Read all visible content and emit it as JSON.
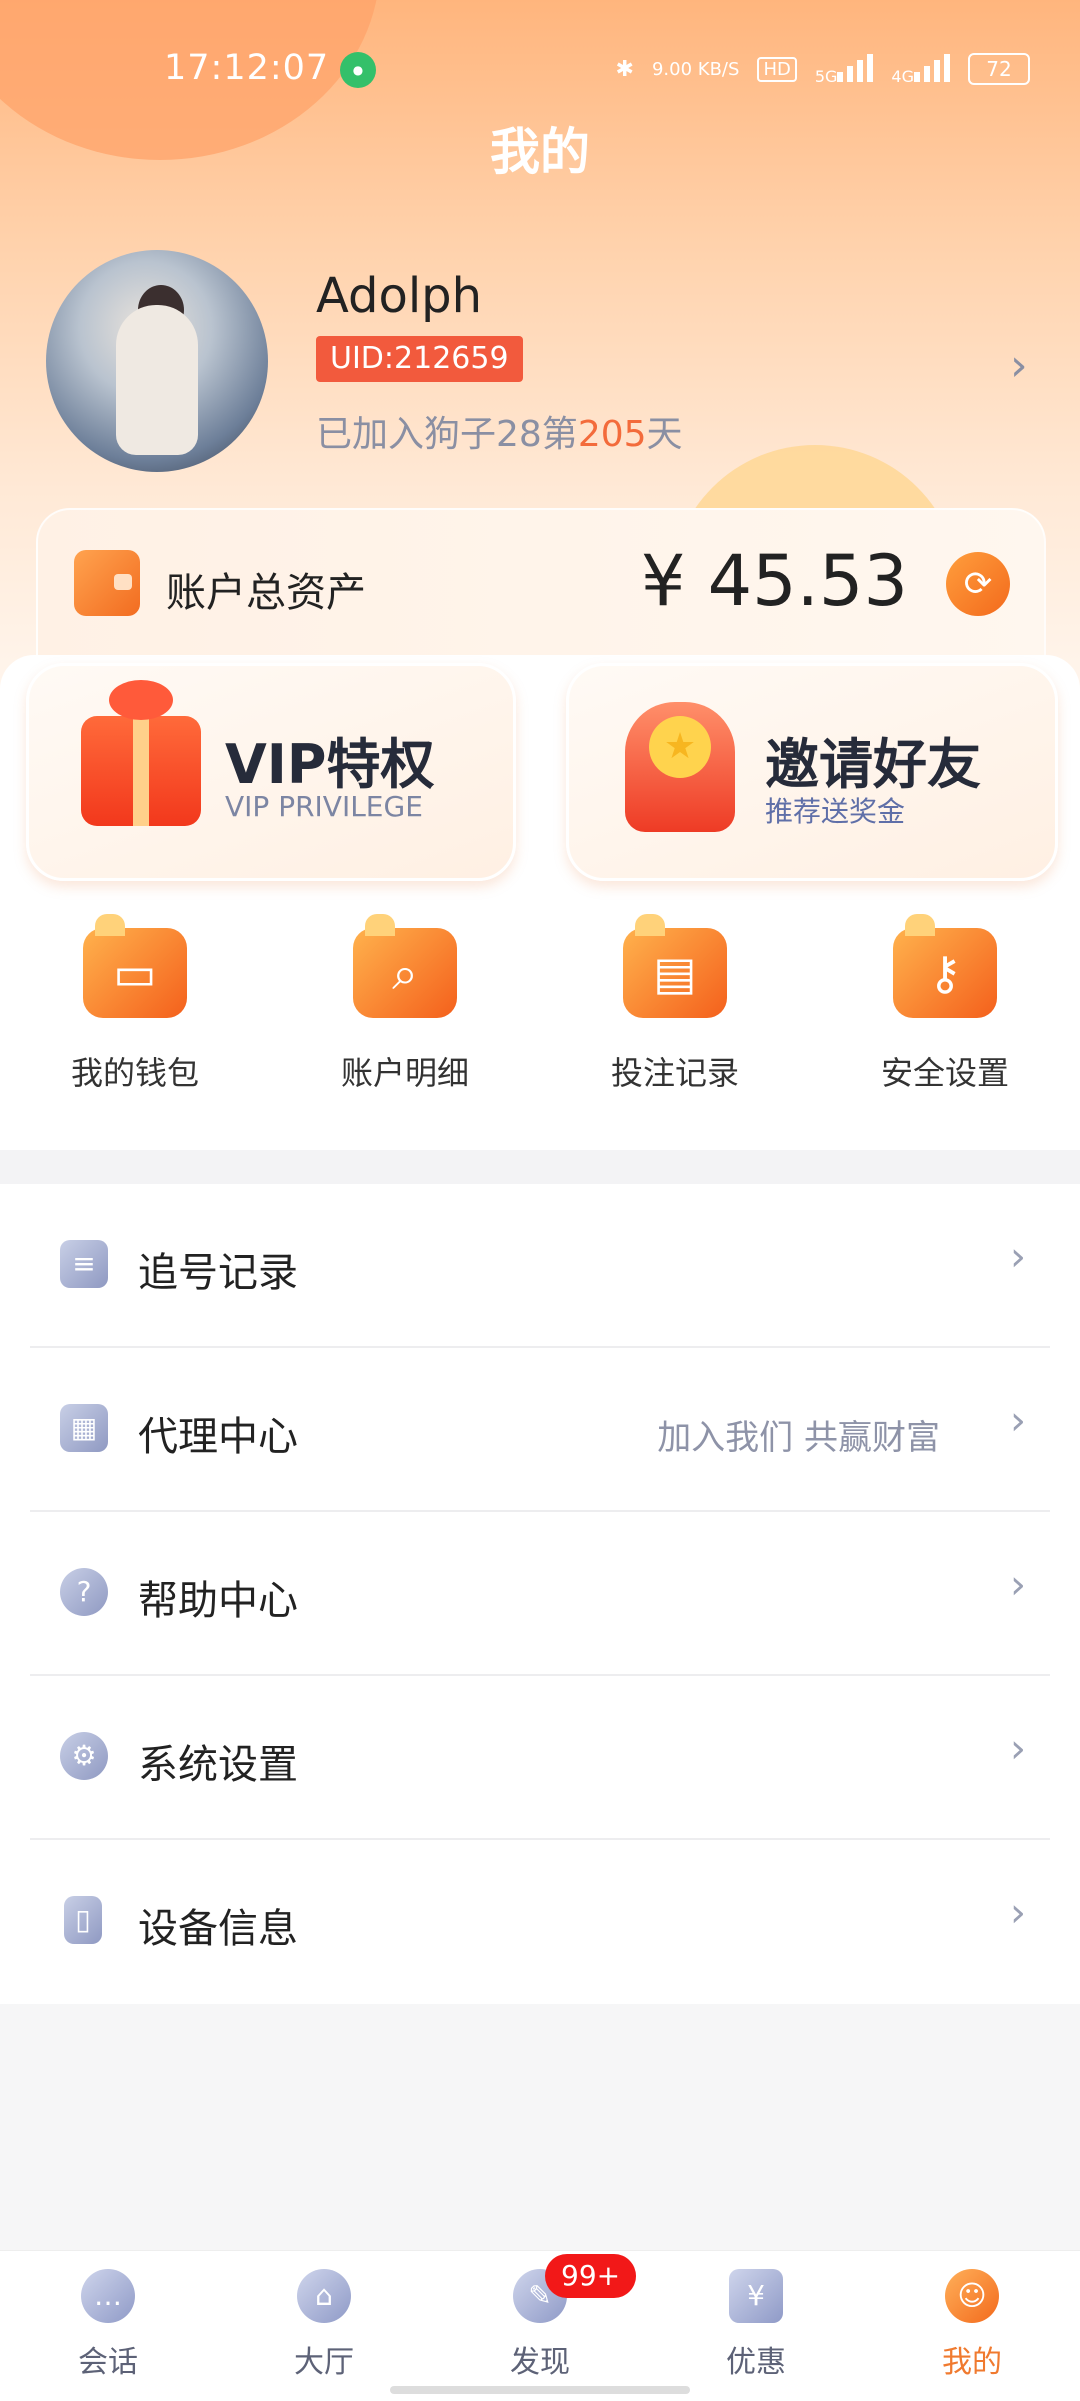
{
  "status_bar": {
    "time": "17:12:07",
    "speed": "9.00 KB/S",
    "hd": "HD",
    "net1": "5G",
    "net2": "4G",
    "battery": "72"
  },
  "header": {
    "title": "我的"
  },
  "profile": {
    "name": "Adolph",
    "uid": "UID:212659",
    "join_prefix": "已加入狗子28第",
    "join_days": "205",
    "join_suffix": "天"
  },
  "assets": {
    "label": "账户总资产",
    "value": "¥ 45.53"
  },
  "promos": [
    {
      "title": "VIP特权",
      "subtitle": "VIP PRIVILEGE"
    },
    {
      "title": "邀请好友",
      "subtitle": "推荐送奖金"
    }
  ],
  "quick_actions": [
    {
      "label": "我的钱包",
      "icon": "wallet-icon"
    },
    {
      "label": "账户明细",
      "icon": "search-icon"
    },
    {
      "label": "投注记录",
      "icon": "calendar-icon"
    },
    {
      "label": "安全设置",
      "icon": "key-icon"
    }
  ],
  "menu": [
    {
      "label": "追号记录",
      "hint": "",
      "icon": "document-icon"
    },
    {
      "label": "代理中心",
      "hint": "加入我们 共赢财富",
      "icon": "qr-code-icon"
    },
    {
      "label": "帮助中心",
      "hint": "",
      "icon": "help-icon"
    },
    {
      "label": "系统设置",
      "hint": "",
      "icon": "gear-icon"
    },
    {
      "label": "设备信息",
      "hint": "",
      "icon": "device-icon"
    }
  ],
  "tabs": [
    {
      "label": "会话",
      "icon": "chat-icon"
    },
    {
      "label": "大厅",
      "icon": "bank-icon"
    },
    {
      "label": "发现",
      "icon": "compass-icon",
      "badge": "99+"
    },
    {
      "label": "优惠",
      "icon": "coupon-icon"
    },
    {
      "label": "我的",
      "icon": "user-icon",
      "active": true
    }
  ],
  "colors": {
    "accent": "#f07a2f",
    "badge": "#f21818",
    "uid_tag": "#f25a3d"
  }
}
